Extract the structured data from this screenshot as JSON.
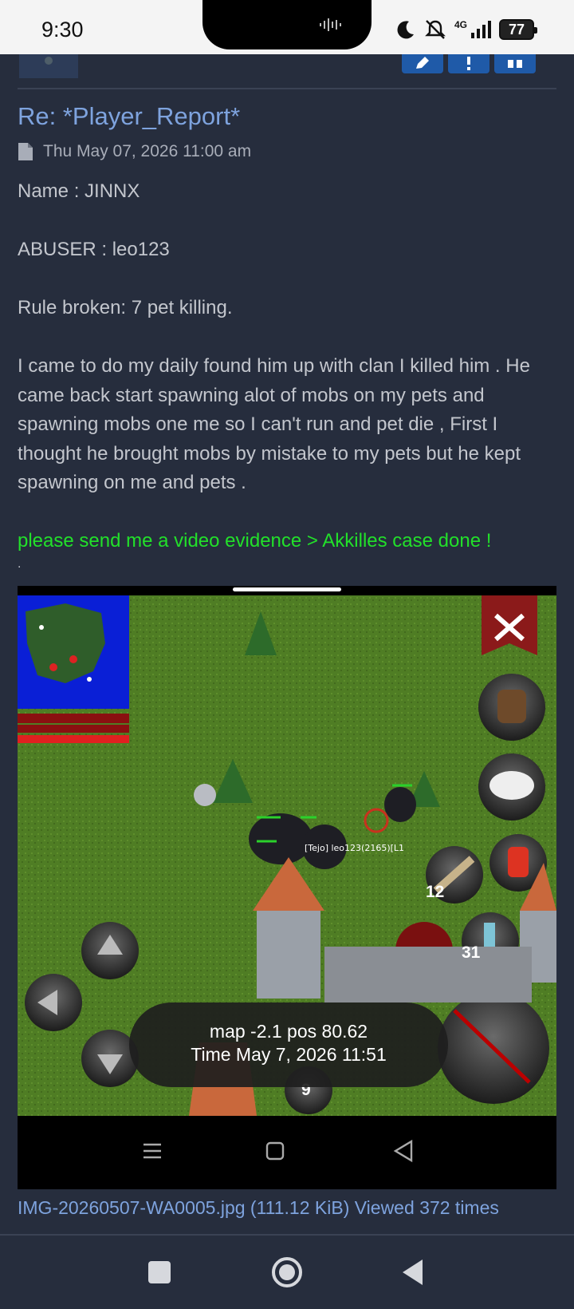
{
  "status_bar": {
    "time": "9:30",
    "network": "4G",
    "battery": "77"
  },
  "post": {
    "title": "Re: *Player_Report*",
    "date": "Thu May 07, 2026 11:00 am",
    "lines": {
      "name": "Name : JINNX",
      "abuser": "ABUSER : leo123",
      "rule": "Rule broken: 7 pet killing.",
      "story": "I came to do my daily found him up with clan I killed him . He came back start spawning alot of mobs on my pets and spawning mobs one me so I can't run and pet die , First I thought he brought mobs by mistake to my pets but he kept spawning on me and pets .",
      "staff_reply": "please send me a video evidence > Akkilles case done !",
      "dot": "."
    }
  },
  "attachment": {
    "player_tag": "[Tejo] leo123(2165)[L1",
    "counts": {
      "fish": "12",
      "potion_blue": "31",
      "slot": "9"
    },
    "toast_line1": "map -2.1 pos 80.62",
    "toast_line2": "Time May 7, 2026 11:51",
    "caption": "IMG-20260507-WA0005.jpg (111.12 KiB) Viewed 372 times"
  },
  "colors": {
    "background": "#262d3d",
    "link": "#7ea3de",
    "staff_text": "#22e02a",
    "button": "#1f5aa8"
  }
}
